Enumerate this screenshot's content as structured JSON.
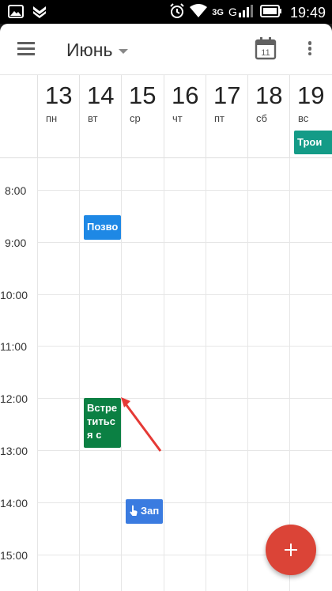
{
  "status_bar": {
    "time": "19:49",
    "network": "3G",
    "signal_label": "G",
    "icons": [
      "image-icon",
      "notification-icon",
      "alarm-icon",
      "wifi-icon",
      "signal-icon",
      "battery-icon"
    ]
  },
  "toolbar": {
    "month": "Июнь",
    "today_icon_day": "11"
  },
  "days": [
    {
      "num": "13",
      "name": "пн"
    },
    {
      "num": "14",
      "name": "вт"
    },
    {
      "num": "15",
      "name": "ср"
    },
    {
      "num": "16",
      "name": "чт"
    },
    {
      "num": "17",
      "name": "пт"
    },
    {
      "num": "18",
      "name": "сб"
    },
    {
      "num": "19",
      "name": "вс"
    }
  ],
  "allday_event": {
    "title": "Трои",
    "color": "#149b87"
  },
  "hours": [
    "8:00",
    "9:00",
    "10:00",
    "11:00",
    "12:00",
    "13:00",
    "14:00",
    "15:00"
  ],
  "events": [
    {
      "title": "Позво",
      "color": "#1e88e5"
    },
    {
      "title": "Встре титьс я с",
      "color": "#0b8043"
    },
    {
      "title": "Зап",
      "color": "#3a7be0",
      "icon": "touch-icon"
    }
  ],
  "fab_color": "#db4437",
  "annotation_arrow_color": "#e53935"
}
